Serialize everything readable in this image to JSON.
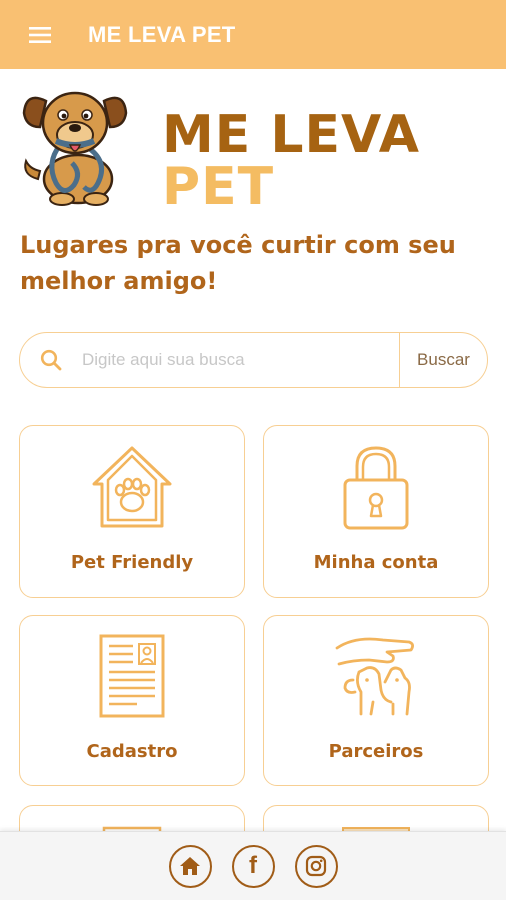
{
  "appbar": {
    "title": "ME LEVA PET",
    "menu_icon": "hamburger-menu-icon"
  },
  "hero": {
    "logo_word1": "ME LEVA",
    "logo_word2": "PET",
    "tagline": "Lugares pra você curtir com seu melhor amigo!"
  },
  "search": {
    "placeholder": "Digite aqui sua busca",
    "value": "",
    "button_label": "Buscar",
    "icon": "search-icon"
  },
  "cards": [
    {
      "label": "Pet Friendly",
      "icon": "pet-house-icon"
    },
    {
      "label": "Minha conta",
      "icon": "lock-icon"
    },
    {
      "label": "Cadastro",
      "icon": "registration-form-icon"
    },
    {
      "label": "Parceiros",
      "icon": "hand-petting-dog-icon"
    }
  ],
  "bottom_nav": [
    {
      "icon": "home-icon"
    },
    {
      "icon": "facebook-icon",
      "label": "f"
    },
    {
      "icon": "instagram-icon"
    }
  ],
  "colors": {
    "appbar": "#f9c072",
    "accent_text": "#b0651b",
    "logo_dark": "#a66312",
    "logo_light": "#f4bc62",
    "card_border": "#f7cf93",
    "icon_stroke": "#f2b45c",
    "bottom_icons": "#a05c17"
  }
}
